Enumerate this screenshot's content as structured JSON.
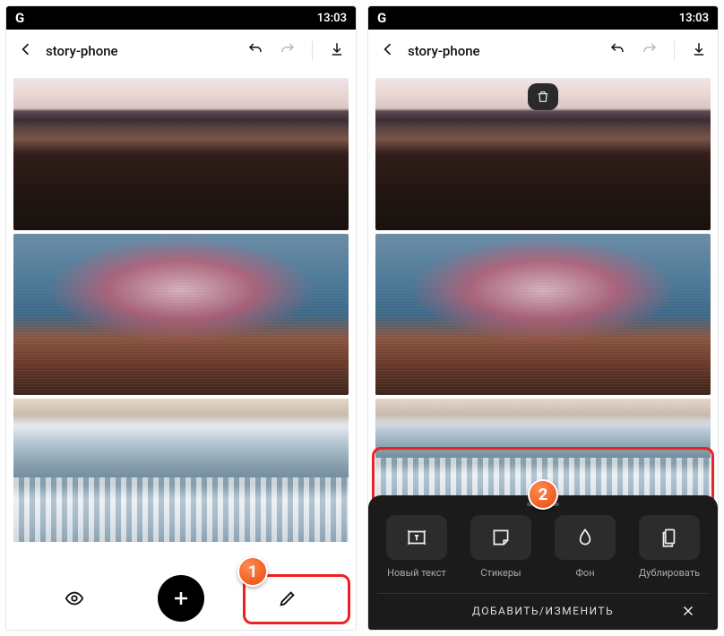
{
  "status": {
    "left_icon": "G",
    "time": "13:03"
  },
  "appbar": {
    "title": "story-phone"
  },
  "bottombar": {
    "preview": "preview",
    "add": "add",
    "edit": "edit"
  },
  "badges": {
    "one": "1",
    "two": "2"
  },
  "panel": {
    "items": [
      {
        "label": "Новый текст"
      },
      {
        "label": "Стикеры"
      },
      {
        "label": "Фон"
      },
      {
        "label": "Дублировать"
      }
    ],
    "footer_title": "ДОБАВИТЬ/ИЗМЕНИТЬ"
  }
}
